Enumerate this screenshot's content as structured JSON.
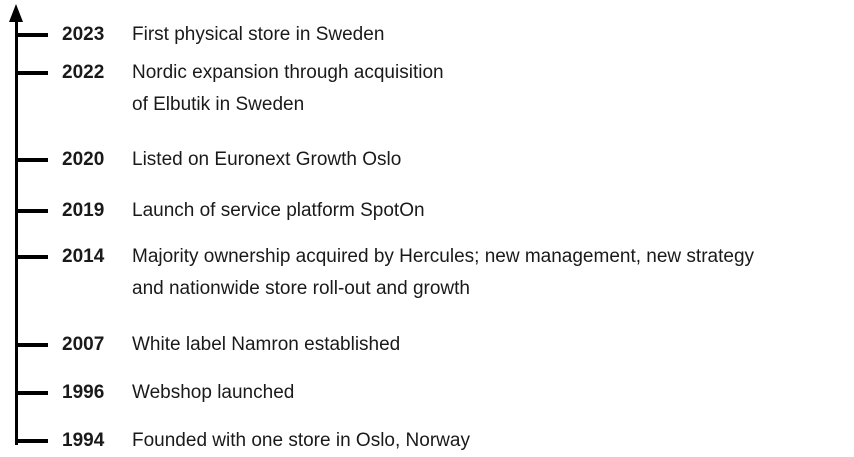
{
  "timeline": {
    "entries": [
      {
        "year": "2023",
        "lines": [
          "First physical store in Sweden"
        ]
      },
      {
        "year": "2022",
        "lines": [
          "Nordic expansion through acquisition",
          "of Elbutik in Sweden"
        ]
      },
      {
        "year": "2020",
        "lines": [
          "Listed on Euronext Growth Oslo"
        ]
      },
      {
        "year": "2019",
        "lines": [
          "Launch of service platform SpotOn"
        ]
      },
      {
        "year": "2014",
        "lines": [
          "Majority ownership acquired by Hercules; new management, new strategy",
          "and nationwide store roll-out and growth"
        ]
      },
      {
        "year": "2007",
        "lines": [
          "White label Namron established"
        ]
      },
      {
        "year": "1996",
        "lines": [
          "Webshop launched"
        ]
      },
      {
        "year": "1994",
        "lines": [
          "Founded with one store in Oslo, Norway"
        ]
      }
    ]
  }
}
